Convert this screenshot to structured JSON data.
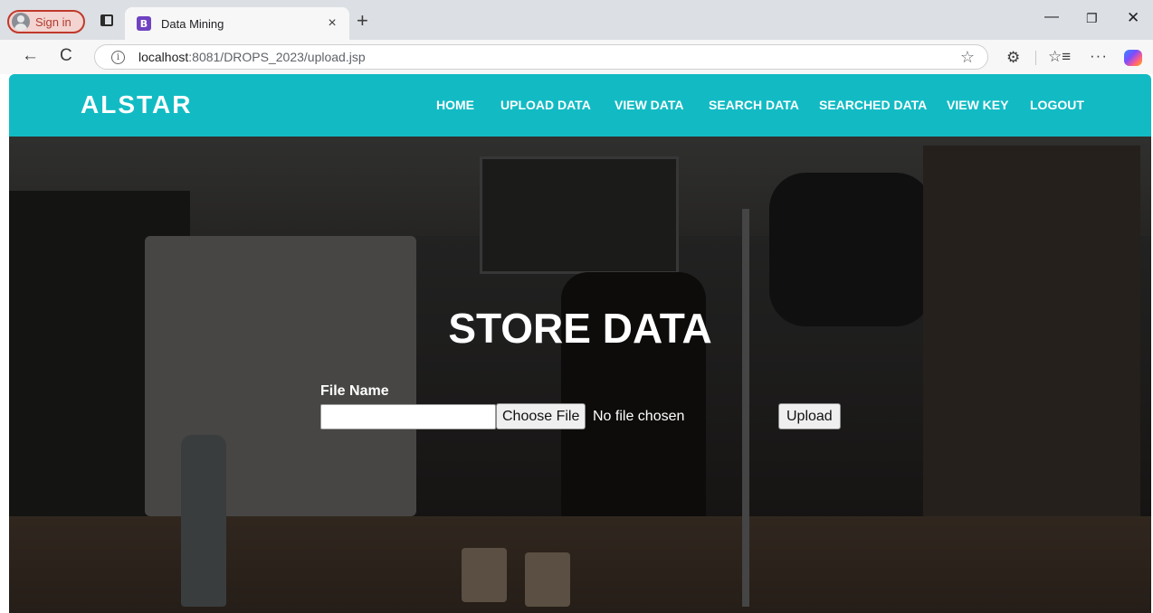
{
  "browser": {
    "signin_label": "Sign in",
    "tab": {
      "title": "Data Mining",
      "favicon_letter": "B"
    },
    "url": {
      "host": "localhost",
      "path": ":8081/DROPS_2023/upload.jsp"
    },
    "icons": {
      "tab_close": "×",
      "new_tab": "+",
      "back": "←",
      "reload": "C",
      "info": "i",
      "star": "☆",
      "extensions": "⚙",
      "favorites": "☆≡",
      "more": "···",
      "minimize": "—",
      "restore": "❐",
      "close": "✕"
    }
  },
  "site": {
    "brand": "ALSTAR",
    "accent": "#12bbc4",
    "nav": {
      "home": "HOME",
      "upload_data": "UPLOAD DATA",
      "view_data": "VIEW DATA",
      "search_data": "SEARCH DATA",
      "searched_data": "SEARCHED DATA",
      "view_key": "VIEW KEY",
      "logout": "LOGOUT"
    }
  },
  "form": {
    "title": "STORE DATA",
    "file_name_label": "File Name",
    "file_name_value": "",
    "choose_file_label": "Choose File",
    "no_file_text": "No file chosen",
    "upload_label": "Upload"
  }
}
